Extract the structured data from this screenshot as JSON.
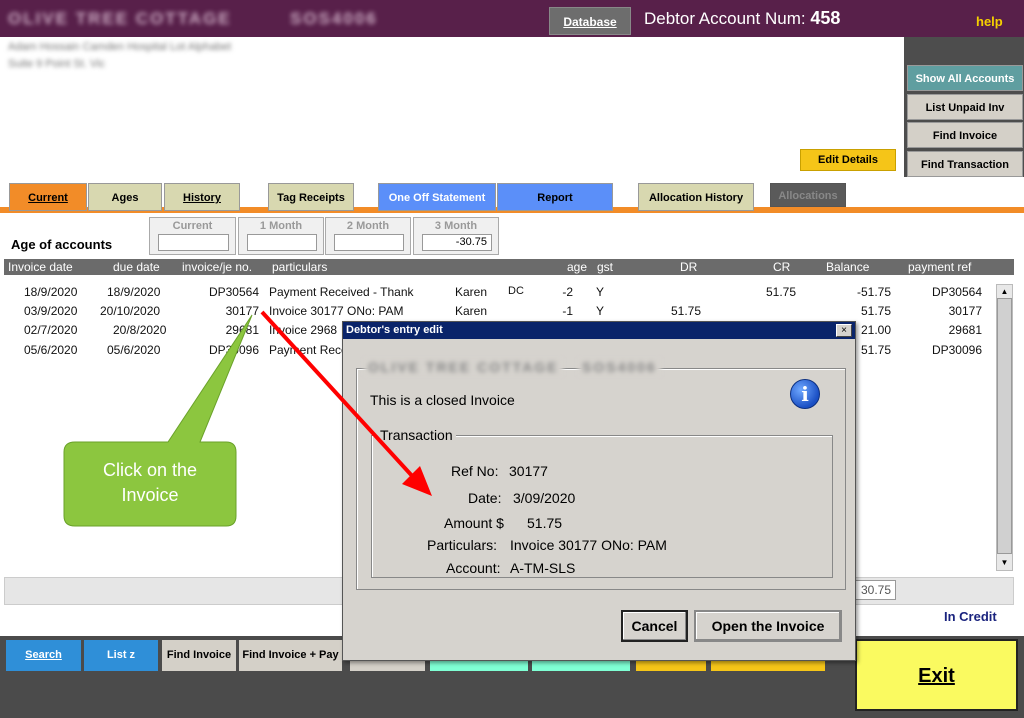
{
  "header": {
    "company_name": "OLIVE TREE COTTAGE",
    "company_code": "SOS4006",
    "database_label": "Database",
    "account_label": "Debtor Account Num:",
    "account_number": "458",
    "help_label": "help"
  },
  "address": {
    "line1": "Adam Hossain Camden Hospital Lot Alphabet",
    "line2": "Suite 9 Point St. Vic"
  },
  "right_panel": {
    "show_all": "Show All Accounts",
    "list_unpaid": "List Unpaid Inv",
    "find_invoice": "Find Invoice",
    "find_transaction": "Find Transaction",
    "edit_details": "Edit Details"
  },
  "tabs": {
    "current": "Current",
    "ages": "Ages",
    "history": "History",
    "tag_receipts": "Tag Receipts",
    "one_off_statement": "One Off Statement",
    "report": "Report",
    "allocation_history": "Allocation History",
    "allocations": "Allocations"
  },
  "ages": {
    "title": "Age of accounts",
    "current_label": "Current",
    "current_value": "",
    "m1_label": "1 Month",
    "m1_value": "",
    "m2_label": "2 Month",
    "m2_value": "",
    "m3_label": "3 Month",
    "m3_value": "-30.75"
  },
  "table": {
    "columns": {
      "invoice_date": "Invoice date",
      "due_date": "due date",
      "invoice_no": "invoice/je no.",
      "particulars": "particulars",
      "age": "age",
      "gst": "gst",
      "dr": "DR",
      "cr": "CR",
      "balance": "Balance",
      "payment_ref": "payment ref"
    },
    "rows": [
      {
        "invoice_date": "18/9/2020",
        "due_date": "18/9/2020",
        "invoice_no": "DP30564",
        "particulars": "Payment Received - Thank",
        "user": "Karen",
        "flag": "DC",
        "age": "-2",
        "gst": "Y",
        "dr": "",
        "cr": "51.75",
        "balance": "-51.75",
        "payment_ref": "DP30564"
      },
      {
        "invoice_date": "03/9/2020",
        "due_date": "20/10/2020",
        "invoice_no": "30177",
        "particulars": "Invoice 30177 ONo: PAM",
        "user": "Karen",
        "flag": "",
        "age": "-1",
        "gst": "Y",
        "dr": "51.75",
        "cr": "",
        "balance": "51.75",
        "payment_ref": "30177"
      },
      {
        "invoice_date": "02/7/2020",
        "due_date": "20/8/2020",
        "invoice_no": "29681",
        "particulars": "Invoice 2968",
        "user": "",
        "flag": "",
        "age": "",
        "gst": "",
        "dr": "",
        "cr": "",
        "balance": "21.00",
        "payment_ref": "29681"
      },
      {
        "invoice_date": "05/6/2020",
        "due_date": "05/6/2020",
        "invoice_no": "DP30096",
        "particulars": "Payment Rece",
        "user": "",
        "flag": "",
        "age": "",
        "gst": "",
        "dr": "",
        "cr": "",
        "balance": "51.75",
        "payment_ref": "DP30096"
      }
    ]
  },
  "footer": {
    "total_value": "30.75",
    "in_credit": "In Credit"
  },
  "bottom_buttons": {
    "search": "Search",
    "list_z": "List z",
    "find_invoice": "Find Invoice",
    "find_invoice_pay": "Find Invoice + Pay",
    "exit": "Exit"
  },
  "dialog": {
    "title": "Debtor's entry edit",
    "close_glyph": "×",
    "blur_name": "OLIVE TREE COTTAGE",
    "blur_code": "SOS4006",
    "message": "This is a closed Invoice",
    "group_label": "Transaction",
    "ref_label": "Ref No:",
    "ref_value": "30177",
    "date_label": "Date:",
    "date_value": "3/09/2020",
    "amount_label": "Amount $",
    "amount_value": "51.75",
    "particulars_label": "Particulars:",
    "particulars_value": "Invoice 30177 ONo: PAM",
    "account_label": "Account:",
    "account_value": "A-TM-SLS",
    "cancel_label": "Cancel",
    "open_label": "Open the Invoice",
    "info_glyph": "i"
  },
  "callout": {
    "text_line1": "Click on the",
    "text_line2": "Invoice",
    "fill": "#8cc63f",
    "arrow_color": "#ff0000"
  }
}
